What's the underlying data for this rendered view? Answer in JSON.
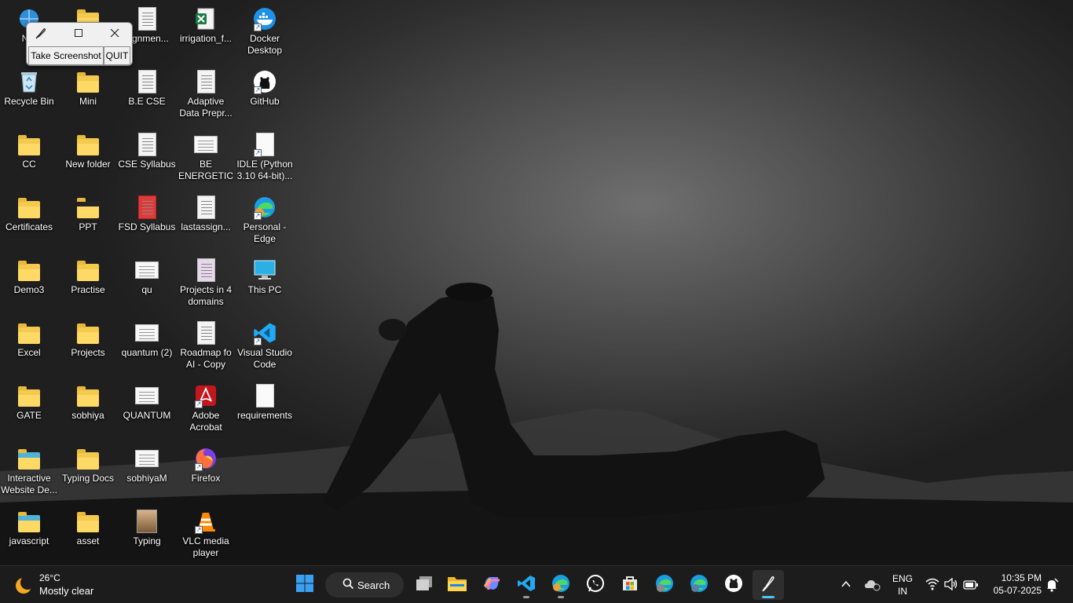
{
  "desktop": {
    "icons": [
      {
        "label": "Net",
        "kind": "network"
      },
      {
        "label": "",
        "kind": "folder"
      },
      {
        "label": "signmen...",
        "kind": "doc"
      },
      {
        "label": "irrigation_f...",
        "kind": "excel"
      },
      {
        "label": "Docker Desktop",
        "kind": "docker"
      },
      {
        "label": "Recycle Bin",
        "kind": "recycle"
      },
      {
        "label": "Mini",
        "kind": "folder"
      },
      {
        "label": "B.E CSE",
        "kind": "doc"
      },
      {
        "label": "Adaptive Data Prepr...",
        "kind": "doc"
      },
      {
        "label": "GitHub",
        "kind": "github"
      },
      {
        "label": "CC",
        "kind": "folder"
      },
      {
        "label": "New folder",
        "kind": "folder"
      },
      {
        "label": "CSE Syllabus",
        "kind": "doc"
      },
      {
        "label": "BE ENERGETIC",
        "kind": "doc-wide"
      },
      {
        "label": "IDLE (Python 3.10 64-bit)...",
        "kind": "doc-plain"
      },
      {
        "label": "Certificates",
        "kind": "folder"
      },
      {
        "label": "PPT",
        "kind": "folder-dark"
      },
      {
        "label": "FSD Syllabus",
        "kind": "pdf"
      },
      {
        "label": "lastassign...",
        "kind": "doc"
      },
      {
        "label": "Personal - Edge",
        "kind": "edge"
      },
      {
        "label": "Demo3",
        "kind": "folder"
      },
      {
        "label": "Practise",
        "kind": "folder"
      },
      {
        "label": "qu",
        "kind": "doc-wide"
      },
      {
        "label": "Projects in 4 domains",
        "kind": "doc-purple"
      },
      {
        "label": "This PC",
        "kind": "thispc"
      },
      {
        "label": "Excel",
        "kind": "folder"
      },
      {
        "label": "Projects",
        "kind": "folder"
      },
      {
        "label": "quantum (2)",
        "kind": "doc-wide"
      },
      {
        "label": "Roadmap fo AI - Copy",
        "kind": "doc"
      },
      {
        "label": "Visual Studio Code",
        "kind": "vscode"
      },
      {
        "label": "GATE",
        "kind": "folder"
      },
      {
        "label": "sobhiya",
        "kind": "folder"
      },
      {
        "label": "QUANTUM",
        "kind": "doc-wide"
      },
      {
        "label": "Adobe Acrobat",
        "kind": "acrobat"
      },
      {
        "label": "requirements",
        "kind": "doc-plain"
      },
      {
        "label": "Interactive Website De...",
        "kind": "folder-blue"
      },
      {
        "label": "Typing Docs",
        "kind": "folder"
      },
      {
        "label": "sobhiyaM",
        "kind": "doc-wide"
      },
      {
        "label": "Firefox",
        "kind": "firefox"
      },
      {
        "label": "",
        "kind": "none"
      },
      {
        "label": "javascript",
        "kind": "folder-blue"
      },
      {
        "label": "asset",
        "kind": "folder"
      },
      {
        "label": "Typing",
        "kind": "image"
      },
      {
        "label": "VLC media player",
        "kind": "vlc"
      },
      {
        "label": "",
        "kind": "none"
      }
    ]
  },
  "app_window": {
    "title_icon": "feather-icon",
    "take_screenshot_label": "Take Screenshot",
    "quit_label": "QUIT"
  },
  "taskbar": {
    "weather_temp": "26°C",
    "weather_condition": "Mostly clear",
    "search_label": "Search",
    "apps": [
      {
        "name": "start",
        "icon": "windows-icon"
      },
      {
        "name": "task-view",
        "icon": "task-view-icon"
      },
      {
        "name": "file-explorer",
        "icon": "folder-icon"
      },
      {
        "name": "copilot",
        "icon": "copilot-icon"
      },
      {
        "name": "vscode",
        "icon": "vscode-icon"
      },
      {
        "name": "edge",
        "icon": "edge-icon"
      },
      {
        "name": "whatsapp",
        "icon": "whatsapp-icon"
      },
      {
        "name": "microsoft-store",
        "icon": "store-icon"
      },
      {
        "name": "edge-profile-2",
        "icon": "edge-icon"
      },
      {
        "name": "edge-profile-3",
        "icon": "edge-icon"
      },
      {
        "name": "github-desktop",
        "icon": "github-icon"
      },
      {
        "name": "feather-app",
        "icon": "feather-icon"
      }
    ],
    "language_line1": "ENG",
    "language_line2": "IN",
    "time": "10:35 PM",
    "date": "05-07-2025"
  },
  "colors": {
    "folder": "#ffd966",
    "taskbar": "#1c1c1c",
    "accent": "#4cc2ff"
  }
}
